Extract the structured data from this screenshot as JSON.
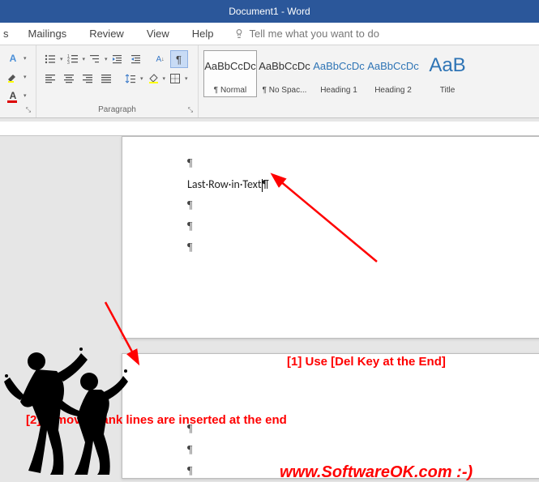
{
  "title_bar": {
    "text": "Document1  -  Word"
  },
  "tabs": {
    "items": [
      {
        "label": "s"
      },
      {
        "label": "Mailings"
      },
      {
        "label": "Review"
      },
      {
        "label": "View"
      },
      {
        "label": "Help"
      }
    ],
    "search_placeholder": "Tell me what you want to do"
  },
  "ribbon": {
    "paragraph_label": "Paragraph",
    "styles": [
      {
        "preview": "AaBbCcDc",
        "name": "¶ Normal",
        "class": "",
        "selected": true
      },
      {
        "preview": "AaBbCcDc",
        "name": "¶ No Spac...",
        "class": ""
      },
      {
        "preview": "AaBbCcDc",
        "name": "Heading 1",
        "class": "heading"
      },
      {
        "preview": "AaBbCcDc",
        "name": "Heading 2",
        "class": "heading"
      },
      {
        "preview": "AaB",
        "name": "Title",
        "class": "title"
      }
    ]
  },
  "document": {
    "page1_lines": [
      "¶",
      "Last·Row·in·Text|¶",
      "¶",
      "¶",
      "¶"
    ],
    "page2_lines": [
      "¶",
      "¶",
      "¶"
    ]
  },
  "annotations": {
    "a1": "[1] Use [Del Key at the End]",
    "a2": "[2] remove blank lines are inserted at the end",
    "site": "www.SoftwareOK.com :-)"
  }
}
